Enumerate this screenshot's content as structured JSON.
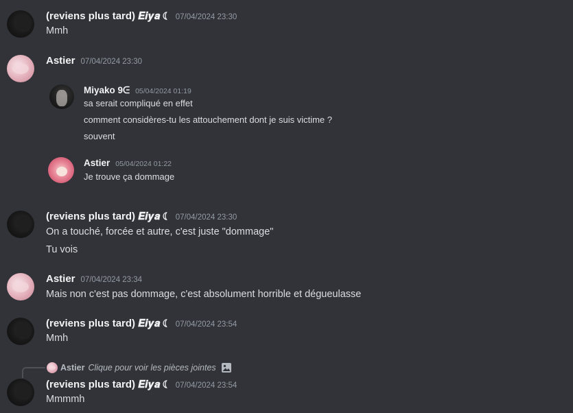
{
  "messages": [
    {
      "author": "(reviens plus tard) 𝑬𝒊𝒚𝒂 ☾",
      "timestamp": "07/04/2024 23:30",
      "lines": [
        "Mmh"
      ]
    },
    {
      "author": "Astier",
      "timestamp": "07/04/2024 23:30",
      "lines": []
    },
    {
      "author": "(reviens plus tard) 𝑬𝒊𝒚𝒂 ☾",
      "timestamp": "07/04/2024 23:30",
      "lines": [
        "On a touché, forcée et autre, c'est juste \"dommage\"",
        "Tu vois"
      ]
    },
    {
      "author": "Astier",
      "timestamp": "07/04/2024 23:34",
      "lines": [
        "Mais non c'est pas dommage, c'est absolument horrible et dégueulasse"
      ]
    },
    {
      "author": "(reviens plus tard) 𝑬𝒊𝒚𝒂 ☾",
      "timestamp": "07/04/2024 23:54",
      "lines": [
        "Mmh"
      ]
    },
    {
      "author": "(reviens plus tard) 𝑬𝒊𝒚𝒂 ☾",
      "timestamp": "07/04/2024 23:54",
      "lines": [
        "Mmmmh"
      ]
    }
  ],
  "embedded_screenshot": [
    {
      "author": "Miyako 9ᕮ",
      "timestamp": "05/04/2024 01:19",
      "lines": [
        "sa serait compliqué en effet",
        "comment considères-tu les attouchement dont je suis victime ?",
        "souvent"
      ]
    },
    {
      "author": "Astier",
      "timestamp": "05/04/2024 01:22",
      "lines": [
        "Je trouve ça dommage"
      ]
    }
  ],
  "reply": {
    "author": "Astier",
    "text": "Clique pour voir les pièces jointes",
    "icon": "image-icon"
  },
  "colors": {
    "background": "#313338",
    "text": "#dbdee1",
    "name": "#f2f3f5",
    "timestamp": "#949ba4",
    "muted": "#b5bac1"
  }
}
